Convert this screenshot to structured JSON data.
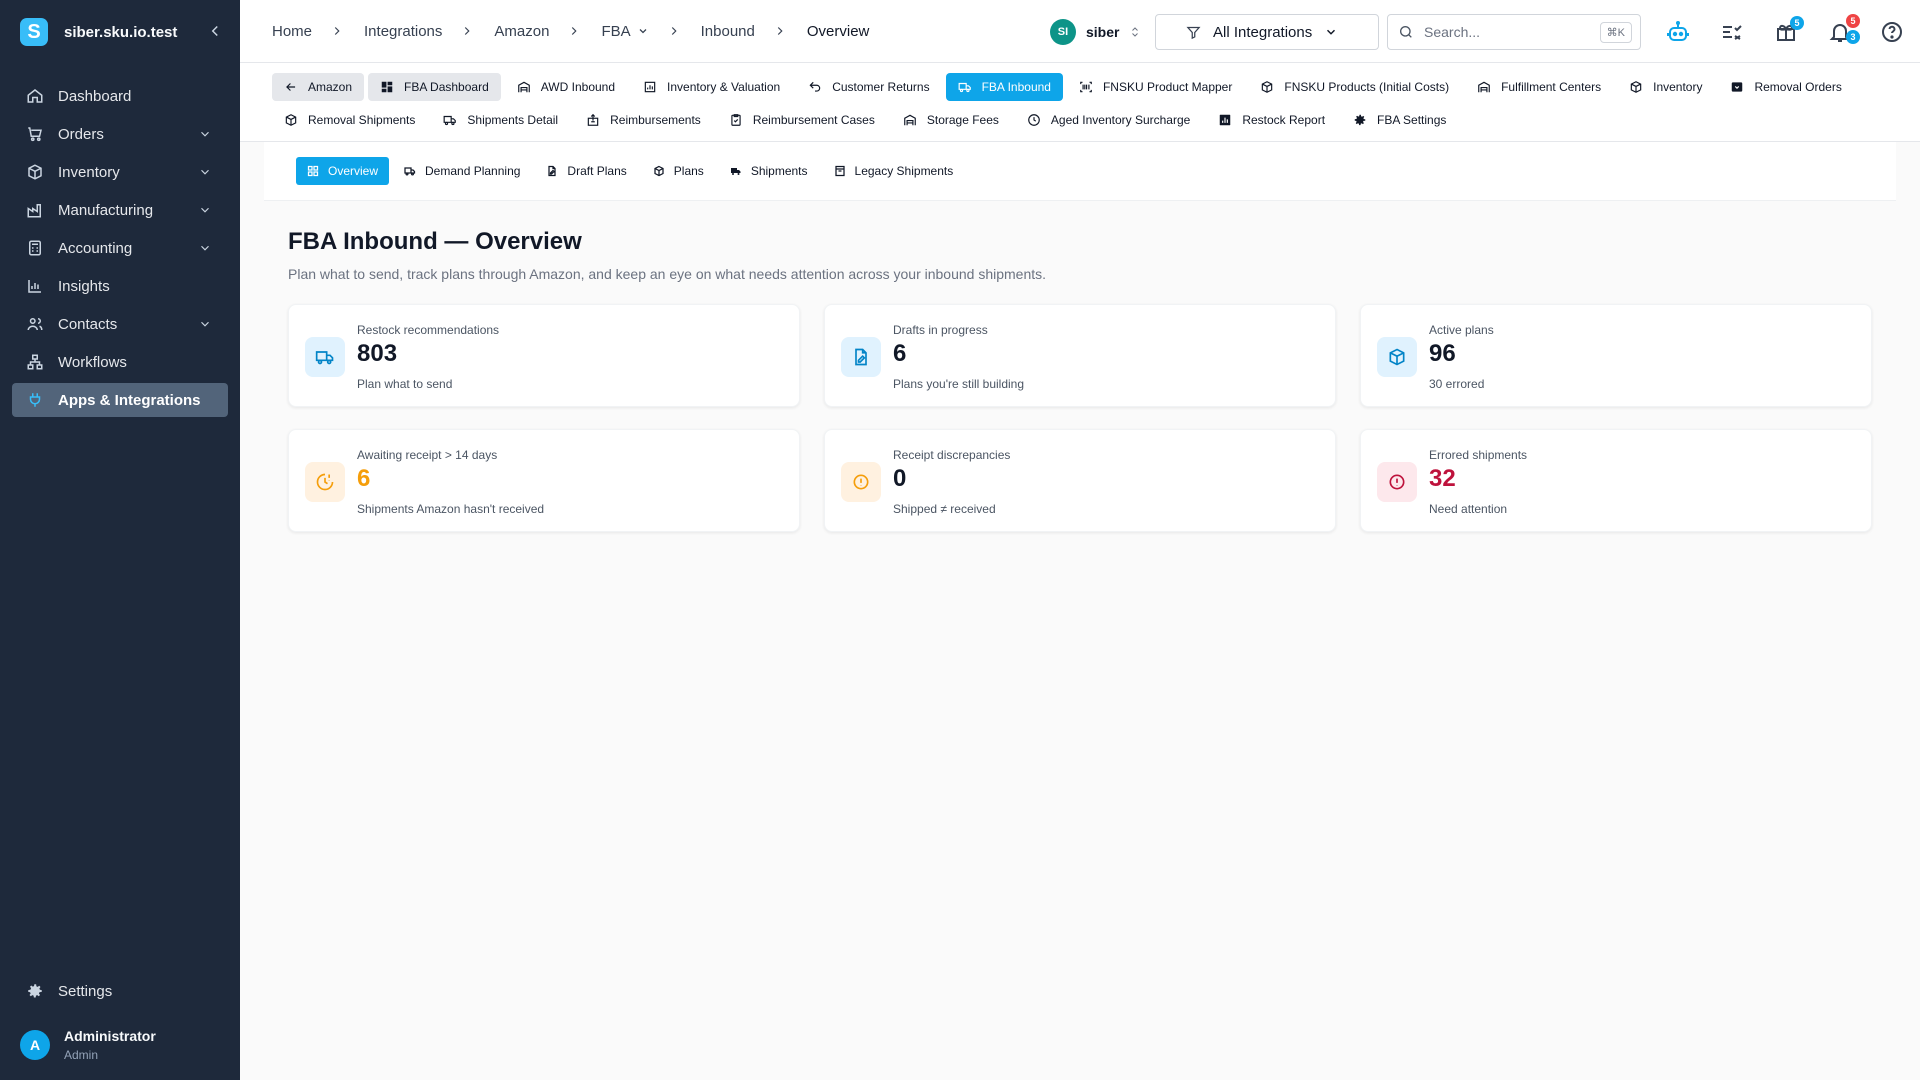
{
  "app": {
    "workspace": "siber.sku.io.test",
    "logo_letter": "S"
  },
  "sidebar": {
    "items": [
      {
        "label": "Dashboard",
        "icon": "home-icon"
      },
      {
        "label": "Orders",
        "icon": "cart-icon"
      },
      {
        "label": "Inventory",
        "icon": "box-icon"
      },
      {
        "label": "Manufacturing",
        "icon": "factory-icon"
      },
      {
        "label": "Accounting",
        "icon": "calculator-icon"
      },
      {
        "label": "Insights",
        "icon": "chart-icon"
      },
      {
        "label": "Contacts",
        "icon": "users-icon"
      },
      {
        "label": "Workflows",
        "icon": "workflow-icon"
      },
      {
        "label": "Apps & Integrations",
        "icon": "plug-icon",
        "active": true
      }
    ],
    "settings": "Settings",
    "user": {
      "name": "Administrator",
      "role": "Admin",
      "initial": "A"
    }
  },
  "breadcrumb": [
    "Home",
    "Integrations",
    "Amazon",
    "FBA",
    "Inbound",
    "Overview"
  ],
  "account": {
    "initials": "SI",
    "name": "siber"
  },
  "filter": {
    "label": "All Integrations"
  },
  "search": {
    "placeholder": "Search...",
    "shortcut": "⌘K"
  },
  "badges": {
    "gifts": "5",
    "notifications_red": "5",
    "notifications_blue": "3"
  },
  "integration_nav": {
    "row1": [
      "Amazon",
      "FBA Dashboard",
      "AWD Inbound",
      "Inventory & Valuation",
      "Customer Returns",
      "FBA Inbound",
      "FNSKU Product Mapper",
      "FNSKU Products (Initial Costs)",
      "Fulfillment Centers",
      "Inventory",
      "Removal Orders"
    ],
    "row2": [
      "Removal Shipments",
      "Shipments Detail",
      "Reimbursements",
      "Reimbursement Cases",
      "Storage Fees",
      "Aged Inventory Surcharge",
      "Restock Report",
      "FBA Settings"
    ]
  },
  "subtabs": [
    "Overview",
    "Demand Planning",
    "Draft Plans",
    "Plans",
    "Shipments",
    "Legacy Shipments"
  ],
  "page": {
    "title": "FBA Inbound — Overview",
    "subtitle": "Plan what to send, track plans through Amazon, and keep an eye on what needs attention across your inbound shipments."
  },
  "cards": [
    {
      "label": "Restock recommendations",
      "value": "803",
      "foot": "Plan what to send",
      "tone": "blue",
      "icon": "truck-icon"
    },
    {
      "label": "Drafts in progress",
      "value": "6",
      "foot": "Plans you're still building",
      "tone": "blue",
      "icon": "file-edit-icon"
    },
    {
      "label": "Active plans",
      "value": "96",
      "foot": "30 errored",
      "tone": "blue",
      "icon": "package-icon"
    },
    {
      "label": "Awaiting receipt > 14 days",
      "value": "6",
      "foot": "Shipments Amazon hasn't received",
      "tone": "orange",
      "icon": "clock-alert-icon"
    },
    {
      "label": "Receipt discrepancies",
      "value": "0",
      "foot": "Shipped ≠ received",
      "tone": "orange",
      "icon": "alert-circle-icon"
    },
    {
      "label": "Errored shipments",
      "value": "32",
      "foot": "Need attention",
      "tone": "red",
      "icon": "error-circle-icon"
    }
  ],
  "colors": {
    "accent": "#0ea5e9",
    "sidebar": "#1e293b",
    "warning": "#f59e0b",
    "danger": "#be123c"
  }
}
